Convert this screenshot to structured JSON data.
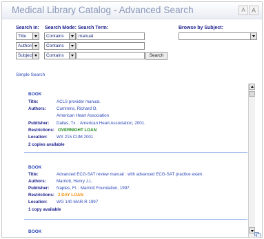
{
  "window": {
    "title": "Medical Library Catalog - Advanced Search",
    "font_smaller": "A",
    "font_larger": "A"
  },
  "search": {
    "search_in_label": "Search in:",
    "search_mode_label": "Search Mode:",
    "search_term_label": "Search Term:",
    "browse_label": "Browse by Subject:",
    "rows": [
      {
        "field": "Title",
        "mode": "Contains",
        "term": "manual"
      },
      {
        "field": "Authors",
        "mode": "Contains",
        "term": ""
      },
      {
        "field": "Subject",
        "mode": "Contains",
        "term": ""
      }
    ],
    "browse_value": "",
    "search_button": "Search"
  },
  "simple_search_link": "Simple Search",
  "labels": {
    "title": "Title:",
    "authors": "Authors:",
    "publisher": "Publisher:",
    "restrictions": "Restrictions:",
    "location": "Location:"
  },
  "results": [
    {
      "type": "BOOK",
      "title": "ACLS provider manual.",
      "authors": [
        "Cummins, Richard O.",
        "American Heart Association"
      ],
      "publisher": "Dallas, Tx. : American Heart Association, 2001.",
      "restriction": "OVERNIGHT LOAN",
      "restriction_color": "#1f8a1f",
      "location": "WX 215 CUM 2001",
      "availability": "2 copies available"
    },
    {
      "type": "BOOK",
      "title": "Advanced ECG-SAT review manual : with advanced ECG-SAT practice exam.",
      "authors": [
        "Marriott, Henry J.L."
      ],
      "publisher": "Naples, Fl. : Marriott Foundation, 1997.",
      "restriction": "2 DAY LOAN",
      "restriction_color": "#f08a00",
      "location": "WG 140 MAR-R 1997",
      "availability": "1 copy available"
    },
    {
      "type": "BOOK"
    }
  ],
  "colors": {
    "title_text": "#8a97b8",
    "link": "#2c47b8",
    "label": "#1a1f8c",
    "separator": "#8fb0e8"
  }
}
